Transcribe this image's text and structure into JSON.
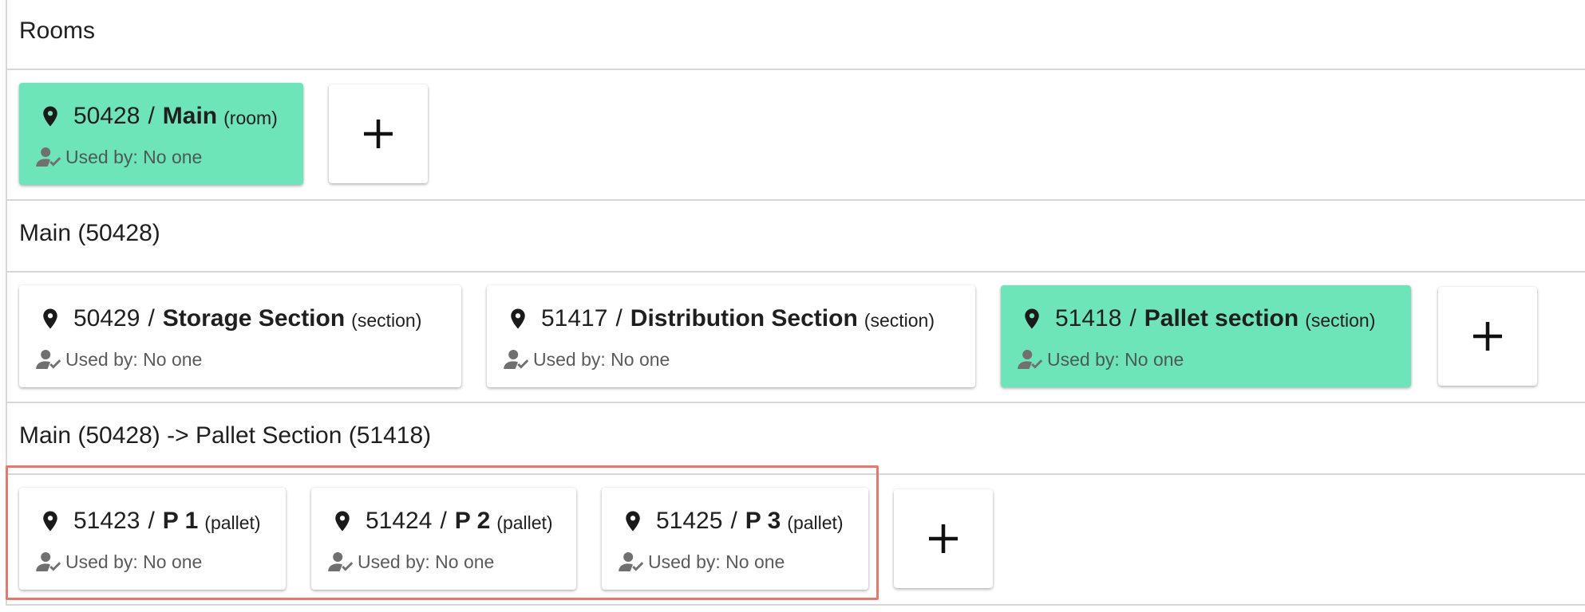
{
  "sections": [
    {
      "header": "Rooms",
      "cards": [
        {
          "id": "50428",
          "name": "Main",
          "type": "(room)",
          "used_by": "Used by: No one",
          "selected": true
        }
      ],
      "add_icon": "plus-icon"
    },
    {
      "header": "Main (50428)",
      "cards": [
        {
          "id": "50429",
          "name": "Storage Section",
          "type": "(section)",
          "used_by": "Used by: No one",
          "selected": false
        },
        {
          "id": "51417",
          "name": "Distribution Section",
          "type": "(section)",
          "used_by": "Used by: No one",
          "selected": false
        },
        {
          "id": "51418",
          "name": "Pallet section",
          "type": "(section)",
          "used_by": "Used by: No one",
          "selected": true
        }
      ],
      "add_icon": "plus-icon"
    },
    {
      "header": "Main (50428) -> Pallet Section (51418)",
      "cards": [
        {
          "id": "51423",
          "name": "P 1",
          "type": "(pallet)",
          "used_by": "Used by: No one",
          "selected": false
        },
        {
          "id": "51424",
          "name": "P 2",
          "type": "(pallet)",
          "used_by": "Used by: No one",
          "selected": false
        },
        {
          "id": "51425",
          "name": "P 3",
          "type": "(pallet)",
          "used_by": "Used by: No one",
          "selected": false
        }
      ],
      "add_icon": "plus-icon"
    }
  ],
  "separator": "/",
  "icons": {
    "location": "location-pin-icon",
    "user": "user-check-icon"
  },
  "colors": {
    "selected": "#6ee5b8",
    "highlight": "#e8776e"
  }
}
